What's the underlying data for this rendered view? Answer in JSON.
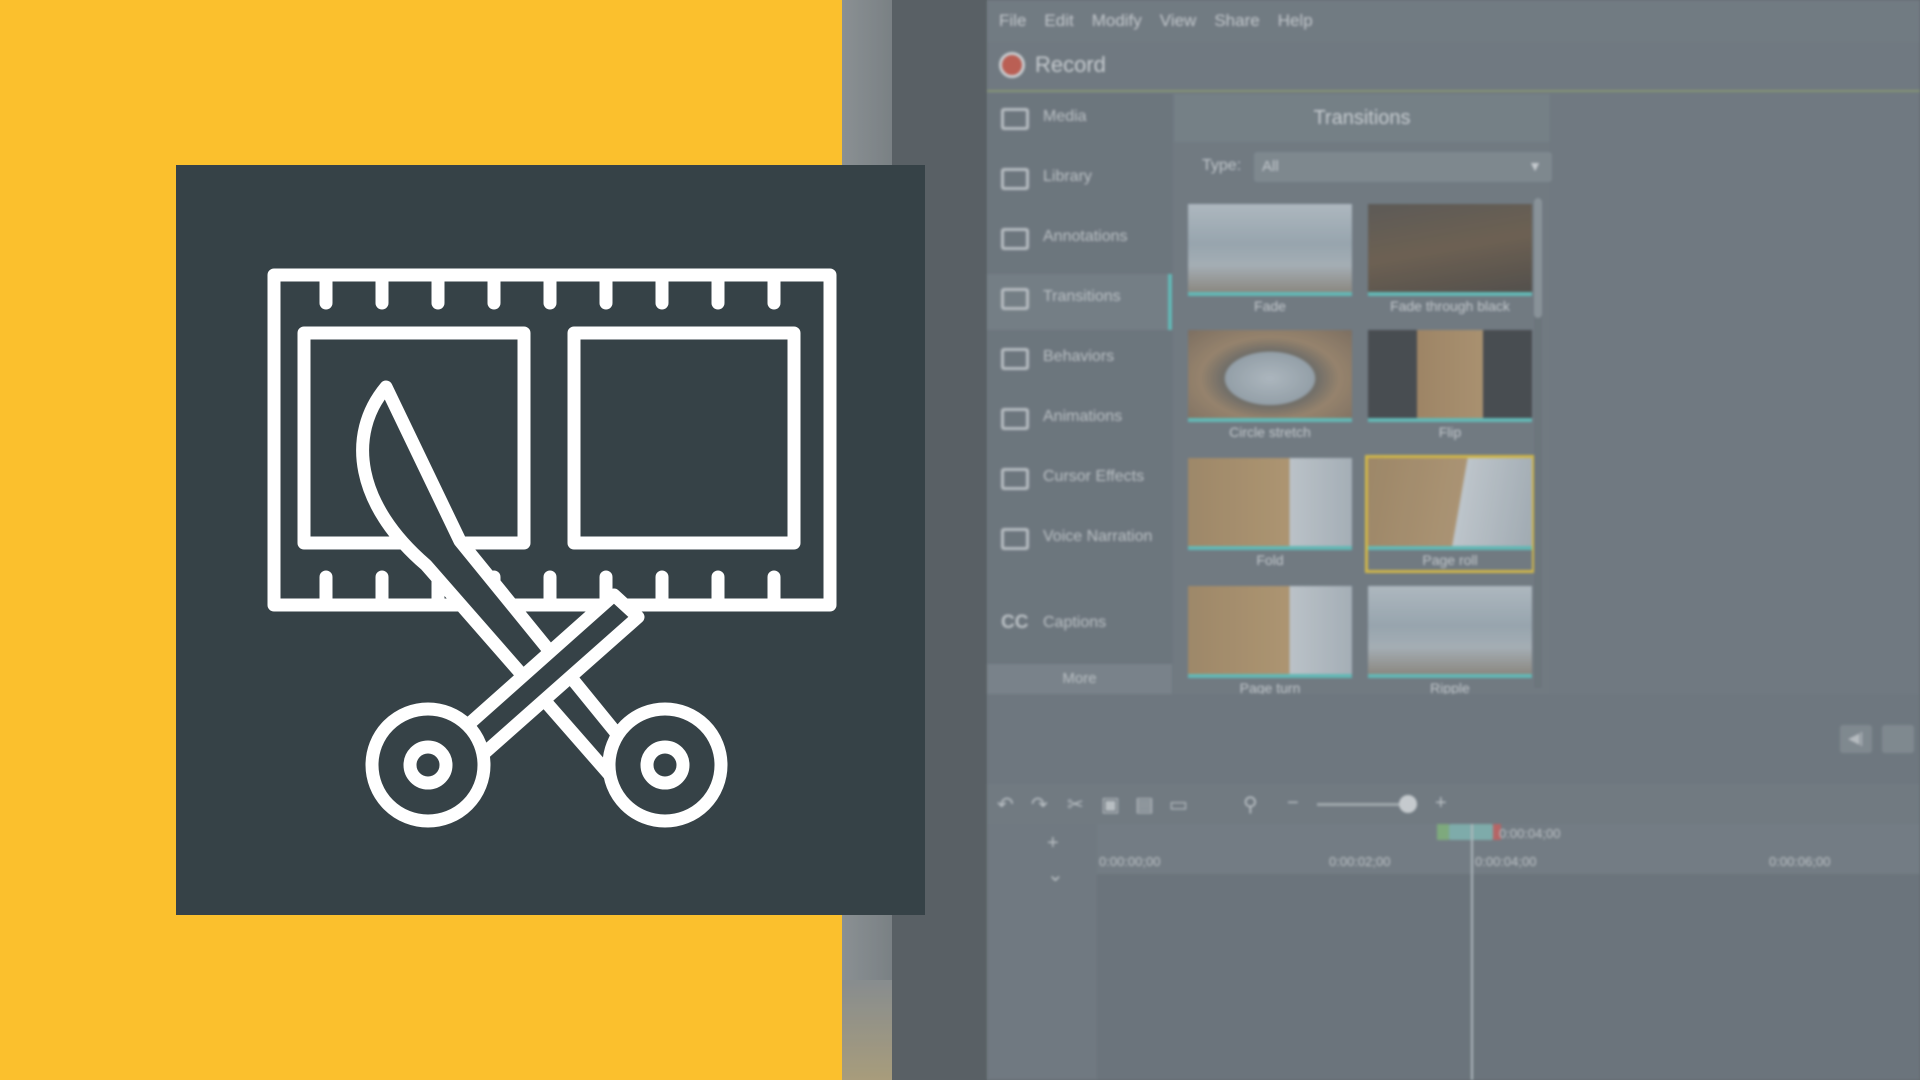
{
  "menu": [
    "File",
    "Edit",
    "Modify",
    "View",
    "Share",
    "Help"
  ],
  "record_label": "Record",
  "sidebar": {
    "items": [
      "Media",
      "Library",
      "Annotations",
      "Transitions",
      "Behaviors",
      "Animations",
      "Cursor Effects",
      "Voice Narration",
      "Captions"
    ],
    "captions_icon": "CC",
    "more_label": "More",
    "active": "Transitions"
  },
  "transitions": {
    "title": "Transitions",
    "type_label": "Type:",
    "type_value": "All",
    "items": [
      "Fade",
      "Fade through black",
      "Circle stretch",
      "Flip",
      "Fold",
      "Page roll",
      "Page turn",
      "Ripple"
    ],
    "selected": "Page roll"
  },
  "timeline": {
    "ticks": [
      "0:00:00;00",
      "0:00:02;00",
      "0:00:04;00",
      "0:00:06;00"
    ],
    "playhead_time": "0:00:04;00"
  },
  "icons": {
    "hero": "film-strip-scissors-icon"
  },
  "colors": {
    "yellow": "#FBC02D",
    "card": "#364247",
    "accent_teal": "#5EC4C0",
    "selection": "#E2C23C"
  }
}
